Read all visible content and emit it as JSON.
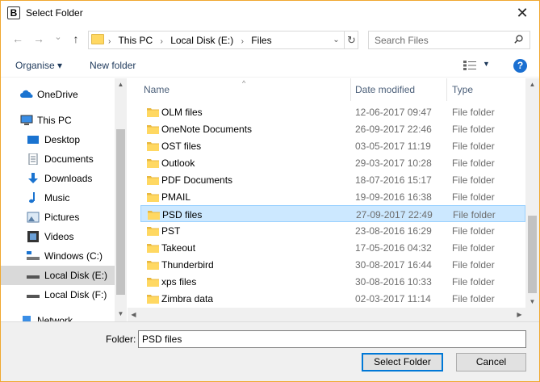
{
  "window": {
    "title": "Select Folder",
    "app_icon_letter": "B"
  },
  "nav": {
    "back": "←",
    "forward": "→",
    "recent": "⌄",
    "up": "↑",
    "breadcrumbs": [
      "This PC",
      "Local Disk (E:)",
      "Files"
    ],
    "search_placeholder": "Search Files"
  },
  "toolbar": {
    "organise": "Organise ▾",
    "new_folder": "New folder",
    "help": "?"
  },
  "sidebar": {
    "items": [
      {
        "label": "OneDrive",
        "icon": "cloud-icon"
      },
      {
        "label": "This PC",
        "icon": "computer-icon"
      },
      {
        "label": "Desktop",
        "icon": "desktop-icon"
      },
      {
        "label": "Documents",
        "icon": "documents-icon"
      },
      {
        "label": "Downloads",
        "icon": "download-icon"
      },
      {
        "label": "Music",
        "icon": "music-icon"
      },
      {
        "label": "Pictures",
        "icon": "pictures-icon"
      },
      {
        "label": "Videos",
        "icon": "videos-icon"
      },
      {
        "label": "Windows (C:)",
        "icon": "drive-icon"
      },
      {
        "label": "Local Disk (E:)",
        "icon": "drive-icon"
      },
      {
        "label": "Local Disk (F:)",
        "icon": "drive-icon"
      },
      {
        "label": "Network",
        "icon": "network-icon"
      }
    ],
    "selected": "Local Disk (E:)"
  },
  "columns": {
    "name": "Name",
    "date": "Date modified",
    "type": "Type"
  },
  "files": [
    {
      "name": "OLM files",
      "date": "12-06-2017 09:47",
      "type": "File folder"
    },
    {
      "name": "OneNote Documents",
      "date": "26-09-2017 22:46",
      "type": "File folder"
    },
    {
      "name": "OST files",
      "date": "03-05-2017 11:19",
      "type": "File folder"
    },
    {
      "name": "Outlook",
      "date": "29-03-2017 10:28",
      "type": "File folder"
    },
    {
      "name": "PDF Documents",
      "date": "18-07-2016 15:17",
      "type": "File folder"
    },
    {
      "name": "PMAIL",
      "date": "19-09-2016 16:38",
      "type": "File folder"
    },
    {
      "name": "PSD files",
      "date": "27-09-2017 22:49",
      "type": "File folder"
    },
    {
      "name": "PST",
      "date": "23-08-2016 16:29",
      "type": "File folder"
    },
    {
      "name": "Takeout",
      "date": "17-05-2016 04:32",
      "type": "File folder"
    },
    {
      "name": "Thunderbird",
      "date": "30-08-2017 16:44",
      "type": "File folder"
    },
    {
      "name": "xps files",
      "date": "30-08-2016 10:33",
      "type": "File folder"
    },
    {
      "name": "Zimbra data",
      "date": "02-03-2017 11:14",
      "type": "File folder"
    }
  ],
  "selected_file": "PSD files",
  "footer": {
    "folder_label": "Folder:",
    "folder_value": "PSD files",
    "select_button": "Select Folder",
    "cancel_button": "Cancel"
  },
  "colors": {
    "accent": "#0078d7",
    "selection": "#cce8ff",
    "folder": "#ffd862",
    "window_border": "#f0a830"
  }
}
